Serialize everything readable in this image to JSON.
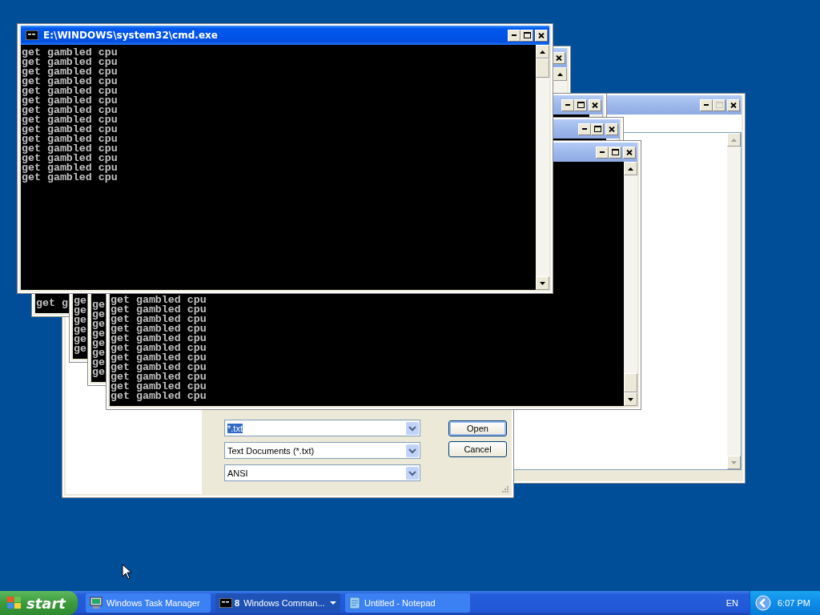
{
  "desktop": {
    "windows": [
      {
        "kind": "console",
        "active": true,
        "title": "E:\\WINDOWS\\system32\\cmd.exe",
        "lines": [
          "get gambled cpu",
          "get gambled cpu",
          "get gambled cpu",
          "get gambled cpu",
          "get gambled cpu",
          "get gambled cpu",
          "get gambled cpu",
          "get gambled cpu",
          "get gambled cpu",
          "get gambled cpu",
          "get gambled cpu",
          "get gambled cpu",
          "get gambled cpu",
          "get gambled cpu"
        ]
      },
      {
        "kind": "console",
        "active": false,
        "lines": [
          "get g"
        ]
      },
      {
        "kind": "console",
        "active": false,
        "lines": [
          "ge",
          "ge",
          "ge",
          "ge",
          "ge",
          "ge"
        ]
      },
      {
        "kind": "console",
        "active": false,
        "lines": [
          "ge",
          "ge",
          "ge",
          "ge",
          "ge",
          "ge",
          "ge",
          "ge"
        ]
      },
      {
        "kind": "console",
        "active": false,
        "lines": [
          "get gambled cpu",
          "get gambled cpu",
          "get gambled cpu",
          "get gambled cpu",
          "get gambled cpu",
          "get gambled cpu",
          "get gambled cpu",
          "get gambled cpu",
          "get gambled cpu",
          "get gambled cpu",
          "get gambled cpu"
        ]
      },
      {
        "kind": "open_dialog",
        "filename": "*.txt",
        "filename_selected": true,
        "file_type": "Text Documents (*.txt)",
        "encoding": "ANSI",
        "buttons": [
          {
            "label": "Open",
            "default": true
          },
          {
            "label": "Cancel",
            "default": false
          }
        ]
      },
      {
        "kind": "notepad",
        "active": false,
        "maximize_disabled": true
      }
    ]
  },
  "taskbar": {
    "start": "start",
    "tasks": [
      {
        "label": "Windows Task Manager",
        "selected": false
      },
      {
        "label": "Windows Comman...",
        "count": "8",
        "selected": true
      },
      {
        "label": "Untitled - Notepad",
        "selected": false
      }
    ],
    "language": "EN",
    "clock": "6:07 PM"
  }
}
